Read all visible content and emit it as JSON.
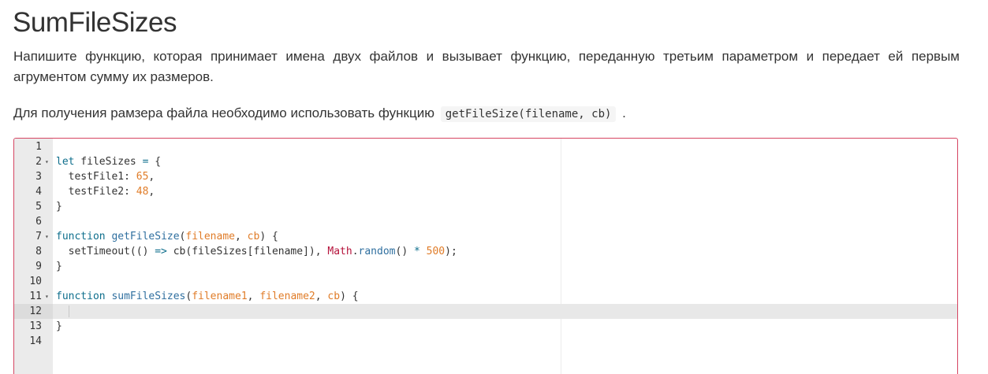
{
  "title": "SumFileSizes",
  "description": "Напишите функцию, которая принимает имена двух файлов и вызывает функцию, переданную третьим параметром и передает ей первым агрументом сумму их размеров.",
  "hint": {
    "before": "Для получения рамзера файла необходимо использовать функцию",
    "code": "getFileSize(filename, cb)",
    "after": "."
  },
  "editor": {
    "active_line": 12,
    "lines": [
      {
        "num": "1",
        "fold": false,
        "tokens": []
      },
      {
        "num": "2",
        "fold": true,
        "tokens": [
          {
            "t": "let",
            "c": "k"
          },
          {
            "t": " fileSizes ",
            "c": "s"
          },
          {
            "t": "=",
            "c": "k"
          },
          {
            "t": " {",
            "c": "s"
          }
        ]
      },
      {
        "num": "3",
        "fold": false,
        "tokens": [
          {
            "t": "  testFile1: ",
            "c": "s"
          },
          {
            "t": "65",
            "c": "n"
          },
          {
            "t": ",",
            "c": "s"
          }
        ]
      },
      {
        "num": "4",
        "fold": false,
        "tokens": [
          {
            "t": "  testFile2: ",
            "c": "s"
          },
          {
            "t": "48",
            "c": "n"
          },
          {
            "t": ",",
            "c": "s"
          }
        ]
      },
      {
        "num": "5",
        "fold": false,
        "tokens": [
          {
            "t": "}",
            "c": "s"
          }
        ]
      },
      {
        "num": "6",
        "fold": false,
        "tokens": []
      },
      {
        "num": "7",
        "fold": true,
        "tokens": [
          {
            "t": "function",
            "c": "k"
          },
          {
            "t": " ",
            "c": "s"
          },
          {
            "t": "getFileSize",
            "c": "f"
          },
          {
            "t": "(",
            "c": "s"
          },
          {
            "t": "filename",
            "c": "p"
          },
          {
            "t": ", ",
            "c": "s"
          },
          {
            "t": "cb",
            "c": "p"
          },
          {
            "t": ") {",
            "c": "s"
          }
        ]
      },
      {
        "num": "8",
        "fold": false,
        "tokens": [
          {
            "t": "  setTimeout(() ",
            "c": "s"
          },
          {
            "t": "=>",
            "c": "k"
          },
          {
            "t": " cb(fileSizes[filename]), ",
            "c": "s"
          },
          {
            "t": "Math",
            "c": "m"
          },
          {
            "t": ".",
            "c": "s"
          },
          {
            "t": "random",
            "c": "f"
          },
          {
            "t": "() ",
            "c": "s"
          },
          {
            "t": "*",
            "c": "k"
          },
          {
            "t": " ",
            "c": "s"
          },
          {
            "t": "500",
            "c": "n"
          },
          {
            "t": ");",
            "c": "s"
          }
        ]
      },
      {
        "num": "9",
        "fold": false,
        "tokens": [
          {
            "t": "}",
            "c": "s"
          }
        ]
      },
      {
        "num": "10",
        "fold": false,
        "tokens": []
      },
      {
        "num": "11",
        "fold": true,
        "tokens": [
          {
            "t": "function",
            "c": "k"
          },
          {
            "t": " ",
            "c": "s"
          },
          {
            "t": "sumFileSizes",
            "c": "f"
          },
          {
            "t": "(",
            "c": "s"
          },
          {
            "t": "filename1",
            "c": "p"
          },
          {
            "t": ", ",
            "c": "s"
          },
          {
            "t": "filename2",
            "c": "p"
          },
          {
            "t": ", ",
            "c": "s"
          },
          {
            "t": "cb",
            "c": "p"
          },
          {
            "t": ") {",
            "c": "s"
          }
        ]
      },
      {
        "num": "12",
        "fold": false,
        "tokens": [
          {
            "t": "  ",
            "c": "s"
          }
        ]
      },
      {
        "num": "13",
        "fold": false,
        "tokens": [
          {
            "t": "}",
            "c": "s"
          }
        ]
      },
      {
        "num": "14",
        "fold": false,
        "tokens": []
      }
    ]
  },
  "colors": {
    "editor_border": "#d64562",
    "keyword": "#0e6e8c",
    "number": "#e07c28",
    "builtin": "#b5123b"
  },
  "icons": {
    "fold": "fold-arrow-icon"
  }
}
